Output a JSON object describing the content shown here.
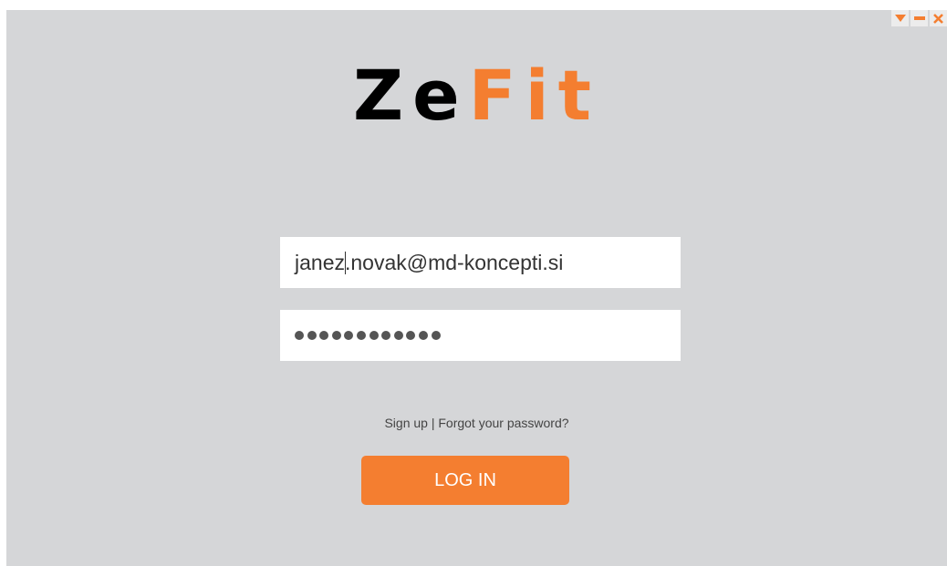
{
  "app": {
    "logo_part1": "Ze",
    "logo_part2": "Fit",
    "accent_color": "#f47e30"
  },
  "window_controls": {
    "icons": [
      "dropdown-arrow-icon",
      "minimize-icon",
      "close-icon"
    ]
  },
  "login": {
    "email_value_before_caret": "janez",
    "email_value_after_caret": ".novak@md-koncepti.si",
    "password_mask_count": 12,
    "signup_label": "Sign up",
    "separator": "|",
    "forgot_label": "Forgot your password?",
    "login_button_label": "LOG IN"
  }
}
